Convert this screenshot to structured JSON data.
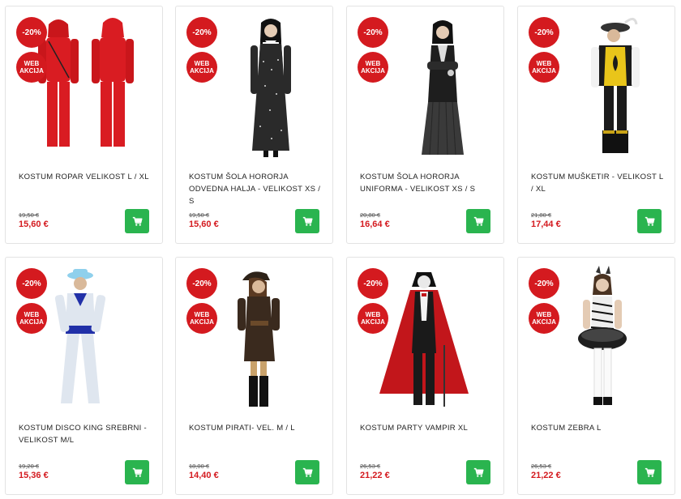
{
  "products": [
    {
      "discount": "-20%",
      "web_badge": "WEB AKCIJA",
      "title": "KOSTUM ROPAR VELIKOST L / XL",
      "old_price": "19,50 €",
      "new_price": "15,60 €",
      "image_icon": "red-jumpsuit-costume-image"
    },
    {
      "discount": "-20%",
      "web_badge": "WEB AKCIJA",
      "title": "KOSTUM ŠOLA HORORJA ODVEDNA HALJA - VELIKOST XS / S",
      "old_price": "19,50 €",
      "new_price": "15,60 €",
      "image_icon": "black-dress-costume-image"
    },
    {
      "discount": "-20%",
      "web_badge": "WEB AKCIJA",
      "title": "KOSTUM ŠOLA HORORJA UNIFORMA - VELIKOST XS / S",
      "old_price": "20,80 €",
      "new_price": "16,64 €",
      "image_icon": "school-uniform-costume-image"
    },
    {
      "discount": "-20%",
      "web_badge": "WEB AKCIJA",
      "title": "KOSTUM MUŠKETIR - VELIKOST L / XL",
      "old_price": "21,80 €",
      "new_price": "17,44 €",
      "image_icon": "musketeer-costume-image"
    },
    {
      "discount": "-20%",
      "web_badge": "WEB AKCIJA",
      "title": "KOSTUM DISCO KING SREBRNI - VELIKOST M/L",
      "old_price": "19,20 €",
      "new_price": "15,36 €",
      "image_icon": "disco-king-costume-image"
    },
    {
      "discount": "-20%",
      "web_badge": "WEB AKCIJA",
      "title": "KOSTUM PIRATI- VEL. M / L",
      "old_price": "18,00 €",
      "new_price": "14,40 €",
      "image_icon": "pirate-costume-image"
    },
    {
      "discount": "-20%",
      "web_badge": "WEB AKCIJA",
      "title": "KOSTUM PARTY VAMPIR XL",
      "old_price": "26,53 €",
      "new_price": "21,22 €",
      "image_icon": "vampire-costume-image"
    },
    {
      "discount": "-20%",
      "web_badge": "WEB AKCIJA",
      "title": "KOSTUM ZEBRA L",
      "old_price": "26,53 €",
      "new_price": "21,22 €",
      "image_icon": "zebra-costume-image"
    }
  ],
  "colors": {
    "badge": "#d41a1f",
    "price": "#d41a1f",
    "cart_button": "#2ab44f",
    "card_border": "#e3e3e3"
  },
  "cart_icon": "shopping-cart-icon"
}
